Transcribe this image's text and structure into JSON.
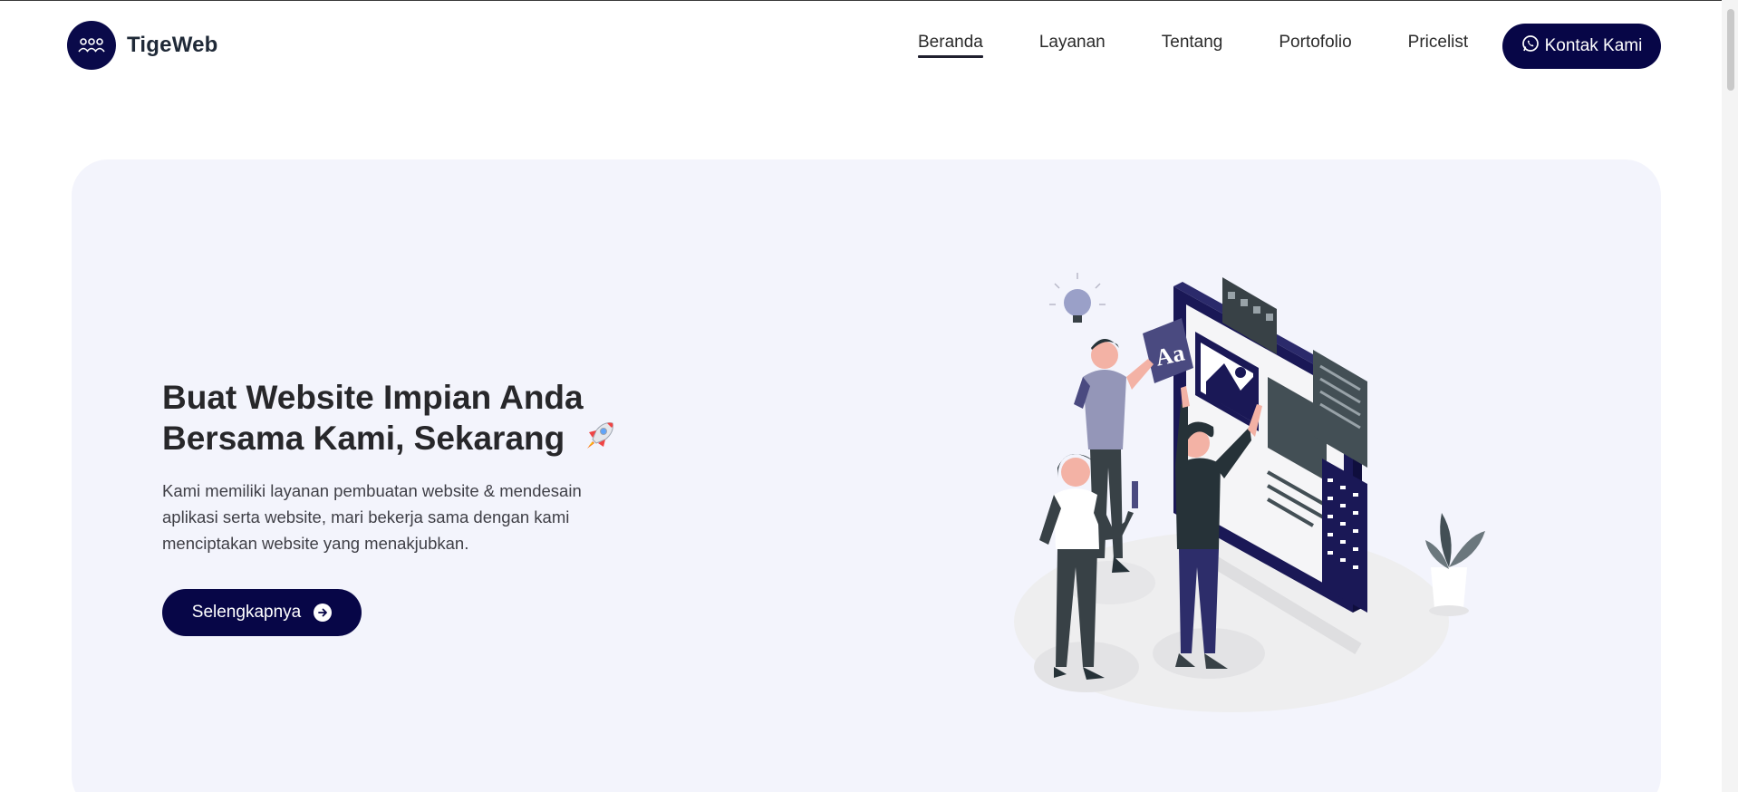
{
  "brand": {
    "name": "TigeWeb",
    "logo_icon": "people-group-icon"
  },
  "nav": {
    "items": [
      {
        "label": "Beranda",
        "active": true
      },
      {
        "label": "Layanan",
        "active": false
      },
      {
        "label": "Tentang",
        "active": false
      },
      {
        "label": "Portofolio",
        "active": false
      },
      {
        "label": "Pricelist",
        "active": false
      }
    ]
  },
  "cta": {
    "label": "Kontak Kami",
    "icon": "whatsapp-icon"
  },
  "hero": {
    "title_line1": "Buat Website Impian Anda",
    "title_line2": "Bersama Kami, Sekarang",
    "title_icon": "rocket-icon",
    "description": "Kami memiliki layanan pembuatan website & mendesain aplikasi serta website, mari bekerja sama dengan kami menciptakan website yang menakjubkan.",
    "button_label": "Selengkapnya",
    "button_icon": "arrow-right-circle-icon",
    "illustration_text": "Aa"
  },
  "colors": {
    "primary": "#070647",
    "hero_bg": "#f3f4fc",
    "text": "#27272a"
  }
}
